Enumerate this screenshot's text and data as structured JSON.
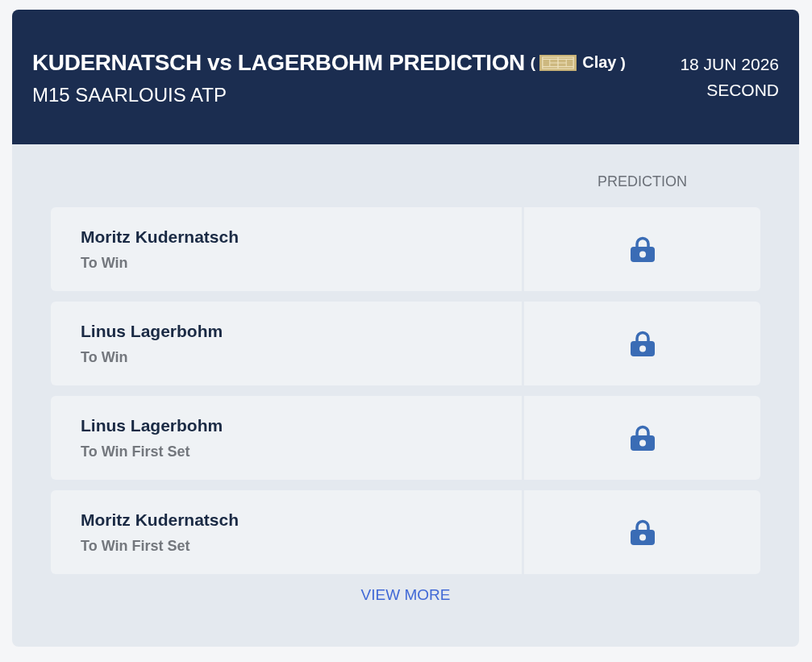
{
  "header": {
    "title": "KUDERNATSCH vs LAGERBOHM PREDICTION",
    "surface": {
      "open_bracket": "(",
      "label": "Clay",
      "close_bracket": ")"
    },
    "subtitle": "M15 SAARLOUIS ATP",
    "date": "18 JUN 2026",
    "round": "SECOND"
  },
  "table": {
    "columns": [
      "PREDICTION"
    ],
    "rows": [
      {
        "player": "Moritz Kudernatsch",
        "market": "To Win",
        "locked": true
      },
      {
        "player": "Linus Lagerbohm",
        "market": "To Win",
        "locked": true
      },
      {
        "player": "Linus Lagerbohm",
        "market": "To Win First Set",
        "locked": true
      },
      {
        "player": "Moritz Kudernatsch",
        "market": "To Win First Set",
        "locked": true
      }
    ]
  },
  "view_more": "VIEW MORE"
}
